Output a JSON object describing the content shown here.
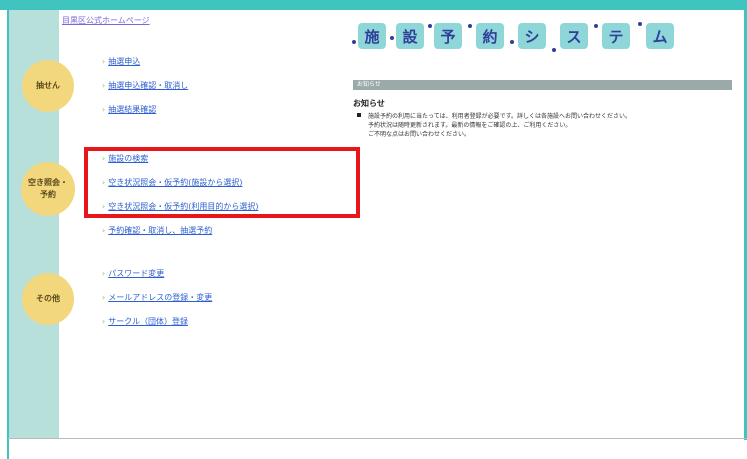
{
  "header": {
    "home_link": "目黒区公式ホームページ",
    "system_title": [
      "施",
      "設",
      "予",
      "約",
      "シ",
      "ス",
      "テ",
      "ム"
    ]
  },
  "sidebar": {
    "sections": [
      {
        "label": "抽せん",
        "items": [
          "抽選申込",
          "抽選申込確認・取消し",
          "抽選結果確認"
        ]
      },
      {
        "label": "空き照会・予約",
        "items": [
          "施設の検索",
          "空き状況照会・仮予約(施設から選択)",
          "空き状況照会・仮予約(利用目的から選択)",
          "予約確認・取消し、抽選予約"
        ]
      },
      {
        "label": "その他",
        "items": [
          "パスワード変更",
          "メールアドレスの登録・変更",
          "サークル（団体）登録"
        ]
      }
    ]
  },
  "main": {
    "section_bar": "お知らせ",
    "notice_heading": "お知らせ",
    "notice_lines": [
      "施設予約の利用に当たっては、利用者登録が必要です。詳しくは各施設へお問い合わせください。",
      "予約状況は随時更新されます。最新の情報をご確認の上、ご利用ください。",
      "ご不明な点はお問い合わせください。"
    ]
  },
  "colors": {
    "frame": "#3fc4c0",
    "sidebar": "#b8e0da",
    "circle": "#f3d77d",
    "link": "#2d5fd0",
    "tile": "#8fd6d8",
    "highlight": "#e8161a"
  }
}
